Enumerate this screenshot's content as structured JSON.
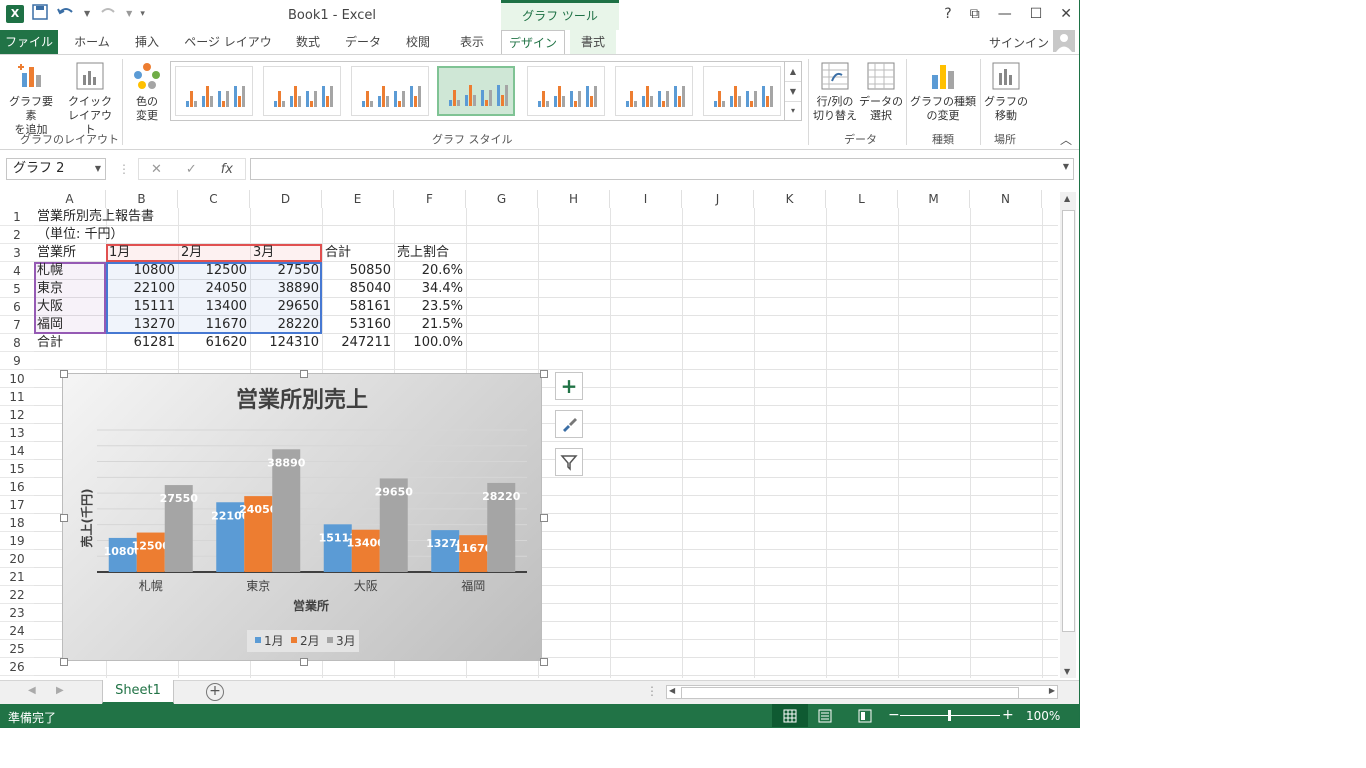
{
  "app": {
    "title": "Book1 - Excel",
    "context_tool": "グラフ ツール"
  },
  "winbtns": {
    "help": "?",
    "ribbon_display": "⧉",
    "minimize": "—",
    "maximize": "☐",
    "close": "✕"
  },
  "tabs": [
    {
      "label": "ファイル"
    },
    {
      "label": "ホーム"
    },
    {
      "label": "挿入"
    },
    {
      "label": "ページ レイアウト"
    },
    {
      "label": "数式"
    },
    {
      "label": "データ"
    },
    {
      "label": "校閲"
    },
    {
      "label": "表示"
    },
    {
      "label": "デザイン"
    },
    {
      "label": "書式"
    }
  ],
  "signin": "サインイン",
  "ribbon": {
    "add_element_1": "グラフ要素",
    "add_element_2": "を追加",
    "quick_layout_1": "クイック",
    "quick_layout_2": "レイアウト",
    "colors_1": "色の",
    "colors_2": "変更",
    "switch_1": "行/列の",
    "switch_2": "切り替え",
    "select_data_1": "データの",
    "select_data_2": "選択",
    "change_type_1": "グラフの種類",
    "change_type_2": "の変更",
    "move_1": "グラフの",
    "move_2": "移動",
    "group_layout": "グラフのレイアウト",
    "group_style": "グラフ スタイル",
    "group_data": "データ",
    "group_type": "種類",
    "group_location": "場所"
  },
  "formula": {
    "namebox": "グラフ 2",
    "fx": "fx",
    "value": ""
  },
  "columns": [
    "A",
    "B",
    "C",
    "D",
    "E",
    "F",
    "G",
    "H",
    "I",
    "J",
    "K",
    "L",
    "M",
    "N"
  ],
  "rows": [
    "1",
    "2",
    "3",
    "4",
    "5",
    "6",
    "7",
    "8",
    "9",
    "10",
    "11",
    "12",
    "13",
    "14",
    "15",
    "16",
    "17",
    "18",
    "19",
    "20",
    "21",
    "22",
    "23",
    "24",
    "25",
    "26"
  ],
  "cells": {
    "a1": "営業所別売上報告書",
    "a2": "（単位: 千円）",
    "header": [
      "営業所",
      "1月",
      "2月",
      "3月",
      "合計",
      "売上割合"
    ],
    "data": [
      [
        "札幌",
        "10800",
        "12500",
        "27550",
        "50850",
        "20.6%"
      ],
      [
        "東京",
        "22100",
        "24050",
        "38890",
        "85040",
        "34.4%"
      ],
      [
        "大阪",
        "15111",
        "13400",
        "29650",
        "58161",
        "23.5%"
      ],
      [
        "福岡",
        "13270",
        "11670",
        "28220",
        "53160",
        "21.5%"
      ],
      [
        "合計",
        "61281",
        "61620",
        "124310",
        "247211",
        "100.0%"
      ]
    ]
  },
  "chart_data": {
    "type": "bar",
    "title": "営業所別売上",
    "xlabel": "営業所",
    "ylabel": "売上(千円)",
    "categories": [
      "札幌",
      "東京",
      "大阪",
      "福岡"
    ],
    "series": [
      {
        "name": "1月",
        "values": [
          10800,
          22100,
          15111,
          13270
        ],
        "color": "#5b9bd5"
      },
      {
        "name": "2月",
        "values": [
          12500,
          24050,
          13400,
          11670
        ],
        "color": "#ed7d31"
      },
      {
        "name": "3月",
        "values": [
          27550,
          38890,
          29650,
          28220
        ],
        "color": "#a5a5a5"
      }
    ],
    "ylim": [
      0,
      45000
    ],
    "legend": "bottom",
    "data_labels": true
  },
  "sheet": {
    "tab": "Sheet1"
  },
  "status": {
    "text": "準備完了",
    "zoom": "100%"
  }
}
